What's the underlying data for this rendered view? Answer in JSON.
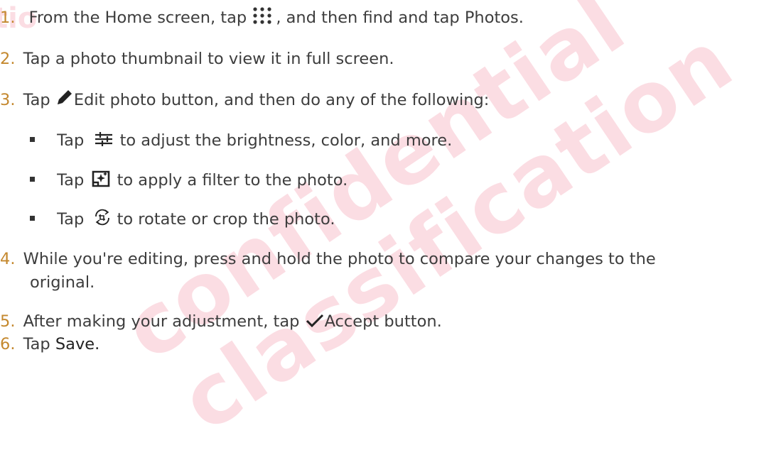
{
  "watermark": {
    "line1": "confidential",
    "line2": "classification",
    "edge_chars": "tio"
  },
  "steps": [
    {
      "num": "1.",
      "before": "From the Home screen, tap",
      "after": ", and then find and tap Photos."
    },
    {
      "num": "2.",
      "text": "Tap a photo thumbnail to view it in full screen."
    },
    {
      "num": "3.",
      "before": "Tap",
      "after": "Edit photo button, and then do any of the following:"
    },
    {
      "num": "4.",
      "line1": "While you're editing, press and hold the photo to compare your changes to the",
      "line2": "original."
    },
    {
      "num": "5.",
      "before": "After making your adjustment, tap",
      "after": "Accept button."
    },
    {
      "num": "6.",
      "before": "Tap",
      "after": "Save."
    }
  ],
  "substeps": [
    {
      "before": "Tap",
      "after": "to adjust the brightness, color, and more."
    },
    {
      "before": "Tap",
      "after": "to apply a filter to the photo."
    },
    {
      "before": "Tap",
      "after": "to rotate or crop the photo."
    }
  ],
  "icons": {
    "apps": "apps-grid-icon",
    "edit": "pencil-icon",
    "adjust": "sliders-icon",
    "filter": "filter-sparkle-icon",
    "rotate": "rotate-crop-icon",
    "accept": "checkmark-icon"
  },
  "colors": {
    "text": "#3d3d3d",
    "step_number": "#c4882e",
    "watermark": "#e10f3c"
  }
}
